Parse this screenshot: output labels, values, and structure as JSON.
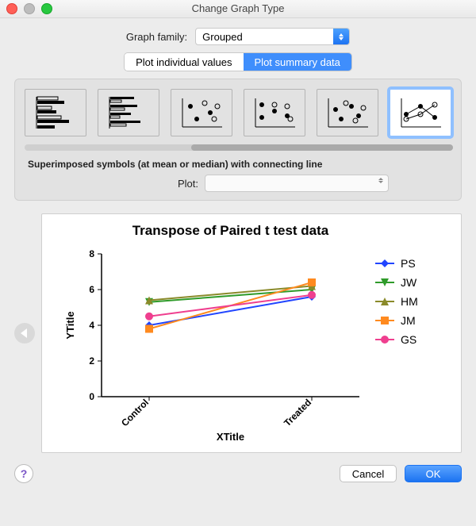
{
  "window": {
    "title": "Change Graph Type"
  },
  "graph_family": {
    "label": "Graph family:",
    "value": "Grouped"
  },
  "tabs": {
    "individual": "Plot individual values",
    "summary": "Plot summary data",
    "active": "summary"
  },
  "panel": {
    "caption": "Superimposed symbols (at mean or median) with connecting line",
    "plot_label": "Plot:",
    "plot_value": ""
  },
  "preview": {
    "title": "Transpose of Paired t test data",
    "ylabel": "YTitle",
    "xlabel": "XTitle"
  },
  "footer": {
    "cancel": "Cancel",
    "ok": "OK"
  },
  "chart_data": {
    "type": "line",
    "categories": [
      "Control",
      "Treated"
    ],
    "series": [
      {
        "name": "PS",
        "values": [
          4.0,
          5.6
        ],
        "color": "#2145ff",
        "marker": "diamond"
      },
      {
        "name": "JW",
        "values": [
          5.3,
          6.0
        ],
        "color": "#2f9b2a",
        "marker": "triangle-down"
      },
      {
        "name": "HM",
        "values": [
          5.4,
          6.2
        ],
        "color": "#8a8a2a",
        "marker": "triangle-up"
      },
      {
        "name": "JM",
        "values": [
          3.8,
          6.4
        ],
        "color": "#ff8a1f",
        "marker": "square"
      },
      {
        "name": "GS",
        "values": [
          4.5,
          5.7
        ],
        "color": "#ef3f8f",
        "marker": "circle"
      }
    ],
    "yticks": [
      0,
      2,
      4,
      6,
      8
    ],
    "ylim": [
      0,
      8
    ]
  }
}
